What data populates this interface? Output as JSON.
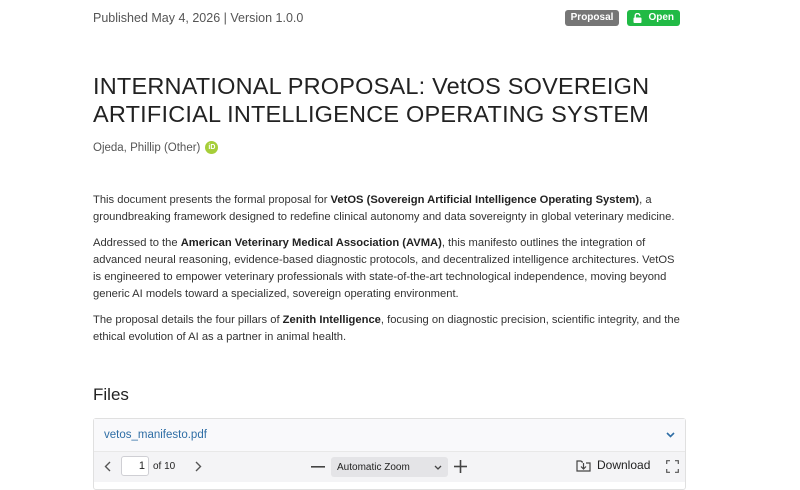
{
  "header": {
    "published": "Published May 4, 2026",
    "separator": "|",
    "version": "Version 1.0.0",
    "badge_type": "Proposal",
    "badge_access": "Open"
  },
  "record": {
    "title": "INTERNATIONAL PROPOSAL: VetOS SOVEREIGN ARTIFICIAL INTELLIGENCE OPERATING SYSTEM",
    "author": "Ojeda, Phillip (Other)",
    "orcid_icon": "iD"
  },
  "description": {
    "p1_pre": "This document presents the formal proposal for ",
    "p1_bold": "VetOS (Sovereign Artificial Intelligence Operating System)",
    "p1_post": ", a groundbreaking framework designed to redefine clinical autonomy and data sovereignty in global veterinary medicine.",
    "p2_pre": "Addressed to the ",
    "p2_bold": "American Veterinary Medical Association (AVMA)",
    "p2_post": ", this manifesto outlines the integration of advanced neural reasoning, evidence-based diagnostic protocols, and decentralized intelligence architectures. VetOS is engineered to empower veterinary professionals with state-of-the-art technological independence, moving beyond generic AI models toward a specialized, sovereign operating environment.",
    "p3_pre": "The proposal details the four pillars of ",
    "p3_bold": "Zenith Intelligence",
    "p3_post": ", focusing on diagnostic precision, scientific integrity, and the ethical evolution of AI as a partner in animal health."
  },
  "files": {
    "heading": "Files",
    "filename": "vetos_manifesto.pdf",
    "viewer": {
      "page_current": "1",
      "page_total": "of 10",
      "zoom": "Automatic Zoom",
      "download": "Download"
    }
  },
  "colors": {
    "badge_proposal": "#767676",
    "badge_open": "#21ba45",
    "link": "#2f6ea5",
    "orcid": "#a6ce39"
  }
}
